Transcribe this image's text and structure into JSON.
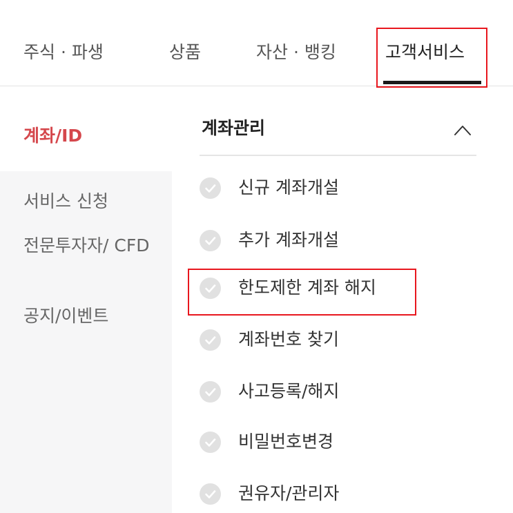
{
  "topnav": {
    "tabs": [
      {
        "label": "주식 · 파생"
      },
      {
        "label": "상품"
      },
      {
        "label": "자산 · 뱅킹"
      },
      {
        "label": "고객서비스"
      }
    ],
    "active_index": 3
  },
  "sidebar": {
    "active_label": "계좌/ID",
    "items": [
      {
        "label": "서비스 신청"
      },
      {
        "label": "전문투자자/ CFD"
      },
      {
        "label": "공지/이벤트"
      }
    ]
  },
  "main": {
    "section_title": "계좌관리",
    "section_expanded": true,
    "items": [
      {
        "label": "신규 계좌개설",
        "icon": "check-circle-icon"
      },
      {
        "label": "추가 계좌개설",
        "icon": "check-circle-icon"
      },
      {
        "label": "한도제한 계좌 해지",
        "icon": "check-circle-icon",
        "highlighted": true
      },
      {
        "label": "계좌번호 찾기",
        "icon": "check-circle-icon"
      },
      {
        "label": "사고등록/해지",
        "icon": "check-circle-icon"
      },
      {
        "label": "비밀번호변경",
        "icon": "check-circle-icon"
      },
      {
        "label": "권유자/관리자",
        "icon": "check-circle-icon"
      }
    ]
  },
  "colors": {
    "accent_red": "#d5474c",
    "highlight_red": "#e8161d",
    "sidebar_bg": "#f6f6f7",
    "check_icon_bg": "#e1e1e1"
  }
}
